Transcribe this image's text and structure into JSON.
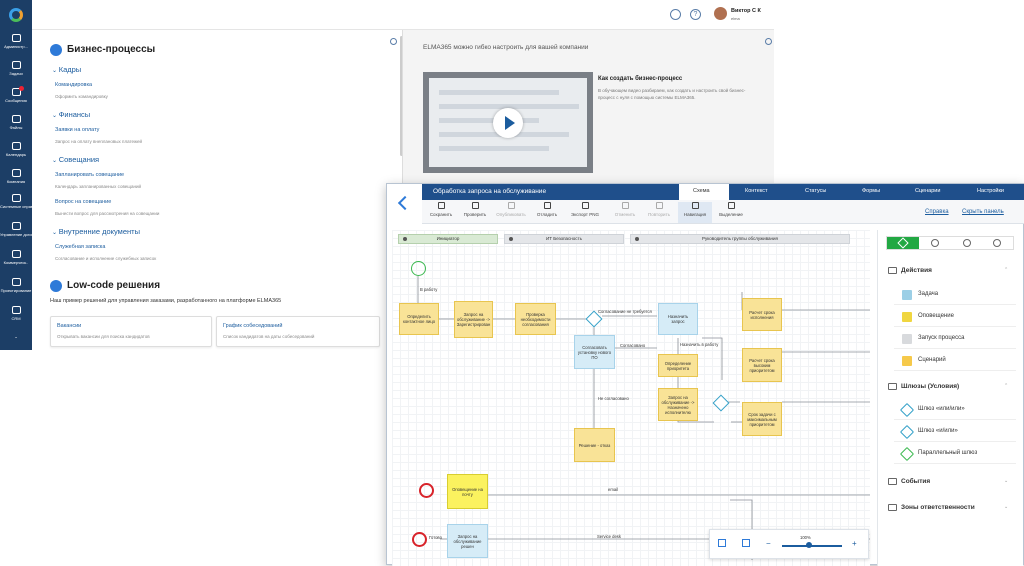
{
  "sidebar": {
    "items": [
      "Администр...",
      "Задачи",
      "Сообщения",
      "Файлы",
      "Календарь",
      "Компания",
      "Системные справочники",
      "Управление договорами",
      "Коммерческ..",
      "Проектирование",
      "CRM"
    ]
  },
  "topbar": {
    "user": "Виктор С К",
    "user_sub": "elma"
  },
  "left": {
    "title": "Бизнес-процессы",
    "sections": [
      {
        "name": "Кадры",
        "items": [
          {
            "label": "Командировка",
            "desc": "Оформить командировку"
          }
        ]
      },
      {
        "name": "Финансы",
        "items": [
          {
            "label": "Заявки на оплату",
            "desc": "Запрос на оплату внеплановых платежей"
          }
        ]
      },
      {
        "name": "Совещания",
        "items": [
          {
            "label": "Запланировать совещание",
            "desc": "Календарь запланированных совещаний"
          },
          {
            "label": "Вопрос на совещание",
            "desc": "Вынести вопрос для рассмотрения на совещании"
          }
        ]
      },
      {
        "name": "Внутренние документы",
        "items": [
          {
            "label": "Служебная записка",
            "desc": "Согласование и исполнение служебных записок"
          }
        ]
      }
    ],
    "lowcode_title": "Low-code решения",
    "lowcode_sub": "Наш пример решений для управления заказами, разработанного на платформе ELMA365",
    "cards": [
      {
        "title": "Вакансии",
        "desc": "Открывать вакансии для поиска кандидатов"
      },
      {
        "title": "График собеседований",
        "desc": "Список кандидатов на даты собеседований"
      }
    ]
  },
  "right": {
    "heading": "ELMA365 можно гибко настроить для вашей компании",
    "video_title": "Как создать бизнес-процесс",
    "video_desc": "В обучающем видео разбираем, как создать и настроить свой бизнес-процесс с нуля с помощью системы ELMA365."
  },
  "editor": {
    "title": "Обработка запроса на обслуживание",
    "tabs": [
      "Схема",
      "Контекст",
      "Статусы",
      "Формы",
      "Сценарии",
      "Настройки"
    ],
    "active_tab": "Схема",
    "tools": [
      "Сохранить",
      "Проверить",
      "Опубликовать",
      "Отладить",
      "Экспорт PNG",
      "Отменить",
      "Повторить",
      "Навигация",
      "Выделение"
    ],
    "links": {
      "help": "Справка",
      "hide": "Скрыть панель"
    },
    "lanes": [
      "Инициатор",
      "ИТ Безопасность",
      "Руководитель группы обслуживания"
    ],
    "nodes": {
      "define": "Определить контактное лицо",
      "register": "Запрос на обслуживание -> Зарегистрирован",
      "check": "Проверка необходимости согласования",
      "assign": "Назначить запрос",
      "approve": "Согласовать установку нового ПО",
      "priority": "Определение приоритета",
      "to_exec": "Запрос на обслуживание -> Назначено исполнителю",
      "calc": "Расчет срока исполнения",
      "calc_high": "Расчет срока высоким приоритетом",
      "deadline": "Срок задачи с максимальным приоритетом",
      "reject": "Решение - отказ",
      "notify": "Оповещение на почту",
      "solved": "Запрос на обслуживание решен"
    },
    "edges": {
      "to_work": "В работу",
      "need_approval": "Согласование не требуется",
      "approved": "Согласовано",
      "not_approved": "Не согласовано",
      "assign_work": "Назначить в работу",
      "email": "email",
      "service_desk": "Service desk",
      "ready": "Готово"
    },
    "zoom": "100%",
    "zoom_level": 0.45,
    "panel": {
      "groups": [
        "Действия",
        "Шлюзы (Условия)",
        "События",
        "Зоны ответственности"
      ],
      "actions": [
        {
          "label": "Задача",
          "color": "#9ccfe6"
        },
        {
          "label": "Оповещение",
          "color": "#f0d640"
        },
        {
          "label": "Запуск процесса",
          "color": "#d8dadd"
        },
        {
          "label": "Сценарий",
          "color": "#f6c94a"
        }
      ],
      "gateways": [
        "Шлюз «или/или»",
        "Шлюз «и/или»",
        "Параллельный шлюз"
      ]
    }
  }
}
